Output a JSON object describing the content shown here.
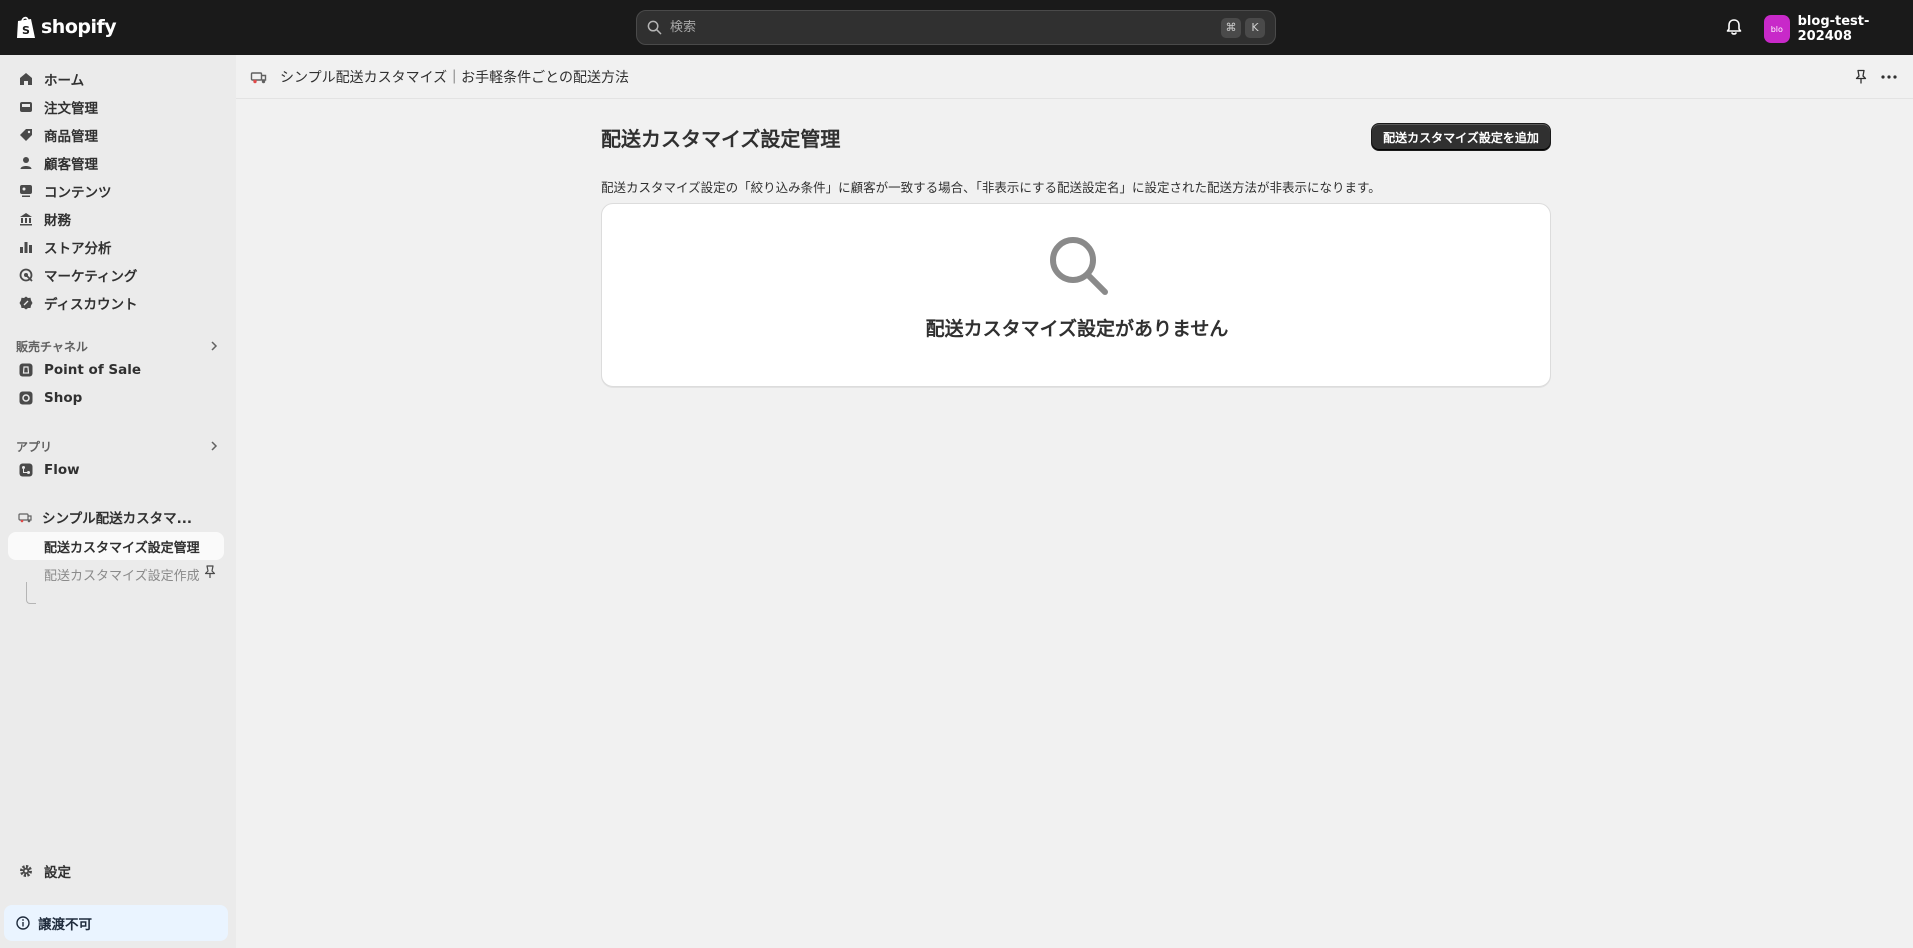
{
  "topbar": {
    "logo_text": "shopify",
    "search_placeholder": "検索",
    "shortcut_keys": [
      "⌘",
      "K"
    ],
    "bell_icon": "bell-icon",
    "store_avatar_text": "blo",
    "store_name": "blog-test-202408",
    "avatar_color": "#c829c9"
  },
  "sidebar": {
    "items": [
      {
        "label": "ホーム",
        "icon": "home-icon"
      },
      {
        "label": "注文管理",
        "icon": "inbox-icon"
      },
      {
        "label": "商品管理",
        "icon": "tag-icon"
      },
      {
        "label": "顧客管理",
        "icon": "person-icon"
      },
      {
        "label": "コンテンツ",
        "icon": "content-icon"
      },
      {
        "label": "財務",
        "icon": "bank-icon"
      },
      {
        "label": "ストア分析",
        "icon": "bar-chart-icon"
      },
      {
        "label": "マーケティング",
        "icon": "target-icon"
      },
      {
        "label": "ディスカウント",
        "icon": "discount-icon"
      }
    ],
    "sales_channels_label": "販売チャネル",
    "sales_channels": [
      {
        "label": "Point of Sale",
        "icon": "pos-icon"
      },
      {
        "label": "Shop",
        "icon": "shop-icon"
      }
    ],
    "apps_label": "アプリ",
    "apps": [
      {
        "label": "Flow",
        "icon": "flow-icon"
      }
    ],
    "current_app": {
      "label": "シンプル配送カスタマ...",
      "subitems": [
        {
          "label": "配送カスタマイズ設定管理",
          "active": true
        },
        {
          "label": "配送カスタマイズ設定作成",
          "active": false
        }
      ]
    },
    "settings_label": "設定",
    "banner_label": "譲渡不可"
  },
  "appbar": {
    "title": "シンプル配送カスタマイズ｜お手軽条件ごとの配送方法"
  },
  "page": {
    "title": "配送カスタマイズ設定管理",
    "add_button": "配送カスタマイズ設定を追加",
    "description": "配送カスタマイズ設定の「絞り込み条件」に顧客が一致する場合、「非表示にする配送設定名」に設定された配送方法が非表示になります。",
    "empty_state": "配送カスタマイズ設定がありません"
  }
}
